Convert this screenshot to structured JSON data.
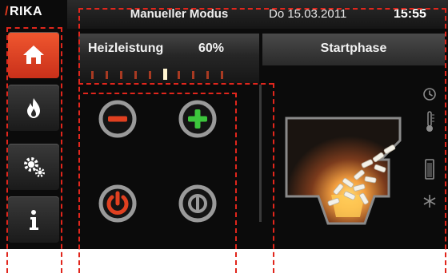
{
  "logo": {
    "text": "RIKA"
  },
  "header": {
    "mode": "Manueller Modus",
    "date": "Do 15.03.2011",
    "time": "15:55"
  },
  "sidebar": {
    "items": [
      {
        "icon": "home-icon",
        "active": true
      },
      {
        "icon": "flame-icon",
        "active": false
      },
      {
        "icon": "settings-icon",
        "active": false
      },
      {
        "icon": "info-icon",
        "active": false
      }
    ]
  },
  "heating": {
    "label": "Heizleistung",
    "value": "60%",
    "level_fraction": 0.6,
    "ticks": 10
  },
  "phase": {
    "label": "Startphase"
  },
  "controls": [
    {
      "icon": "minus-icon",
      "color": "#e04020"
    },
    {
      "icon": "plus-icon",
      "color": "#3cc63c"
    },
    {
      "icon": "power-icon",
      "color": "#e04020"
    },
    {
      "icon": "standby-icon",
      "color": "#9a9a9a"
    }
  ],
  "status_icons": [
    "clock-icon",
    "thermometer-icon",
    "pellet-container-icon",
    "snowflake-icon"
  ],
  "colors": {
    "accent": "#e04020",
    "accent_green": "#3cc63c",
    "annotation": "#e1261c",
    "background": "#0b0b0b"
  }
}
